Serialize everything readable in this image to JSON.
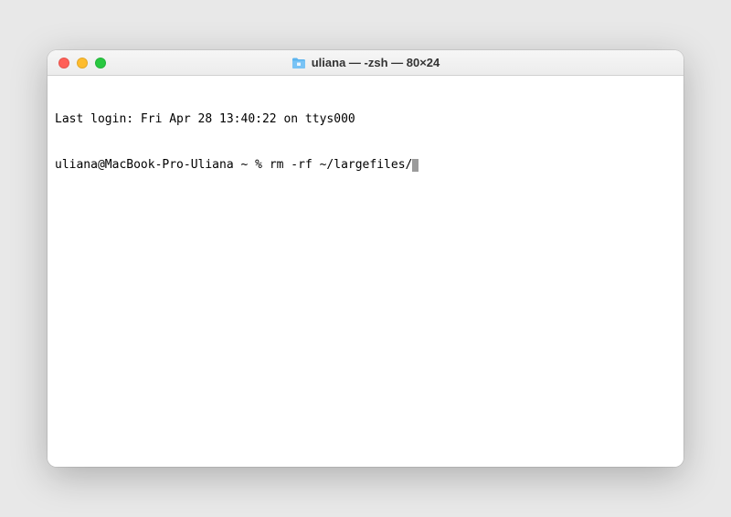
{
  "window": {
    "title": "uliana — -zsh — 80×24"
  },
  "terminal": {
    "last_login": "Last login: Fri Apr 28 13:40:22 on ttys000",
    "prompt": "uliana@MacBook-Pro-Uliana ~ % ",
    "command": "rm -rf ~/largefiles/"
  }
}
